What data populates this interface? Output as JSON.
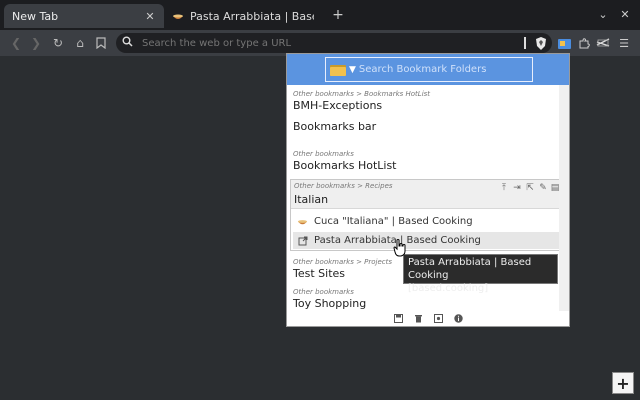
{
  "tabs": [
    {
      "title": "New Tab",
      "active": true
    },
    {
      "title": "Pasta Arrabbiata | Based Coo",
      "active": false,
      "favicon": "bowl-icon"
    }
  ],
  "toolbar": {
    "url_placeholder": "Search the web or type a URL"
  },
  "popup": {
    "search_placeholder": "Search Bookmark Folders",
    "entries": [
      {
        "path": "Other bookmarks > Bookmarks HotList",
        "name": "BMH-Exceptions"
      },
      {
        "path": "",
        "name": "Bookmarks bar"
      },
      {
        "path": "Other bookmarks",
        "name": "Bookmarks HotList"
      },
      {
        "path": "Other bookmarks > Projects",
        "name": "Test Sites"
      },
      {
        "path": "Other bookmarks",
        "name": "Toy Shopping"
      }
    ],
    "expanded": {
      "path": "Other bookmarks > Recipes",
      "name": "Italian",
      "bookmarks": [
        {
          "title": "Cuca \"Italiana\" | Based Cooking",
          "icon": "bowl-icon"
        },
        {
          "title": "Pasta Arrabbiata | Based Cooking",
          "icon": "open-link-icon"
        }
      ]
    }
  },
  "tooltip": {
    "line1": "Pasta Arrabbiata | Based Cooking",
    "line2": "[based.cooking]"
  },
  "colors": {
    "header": "#5b94e0",
    "folder": "#f2c14e"
  }
}
